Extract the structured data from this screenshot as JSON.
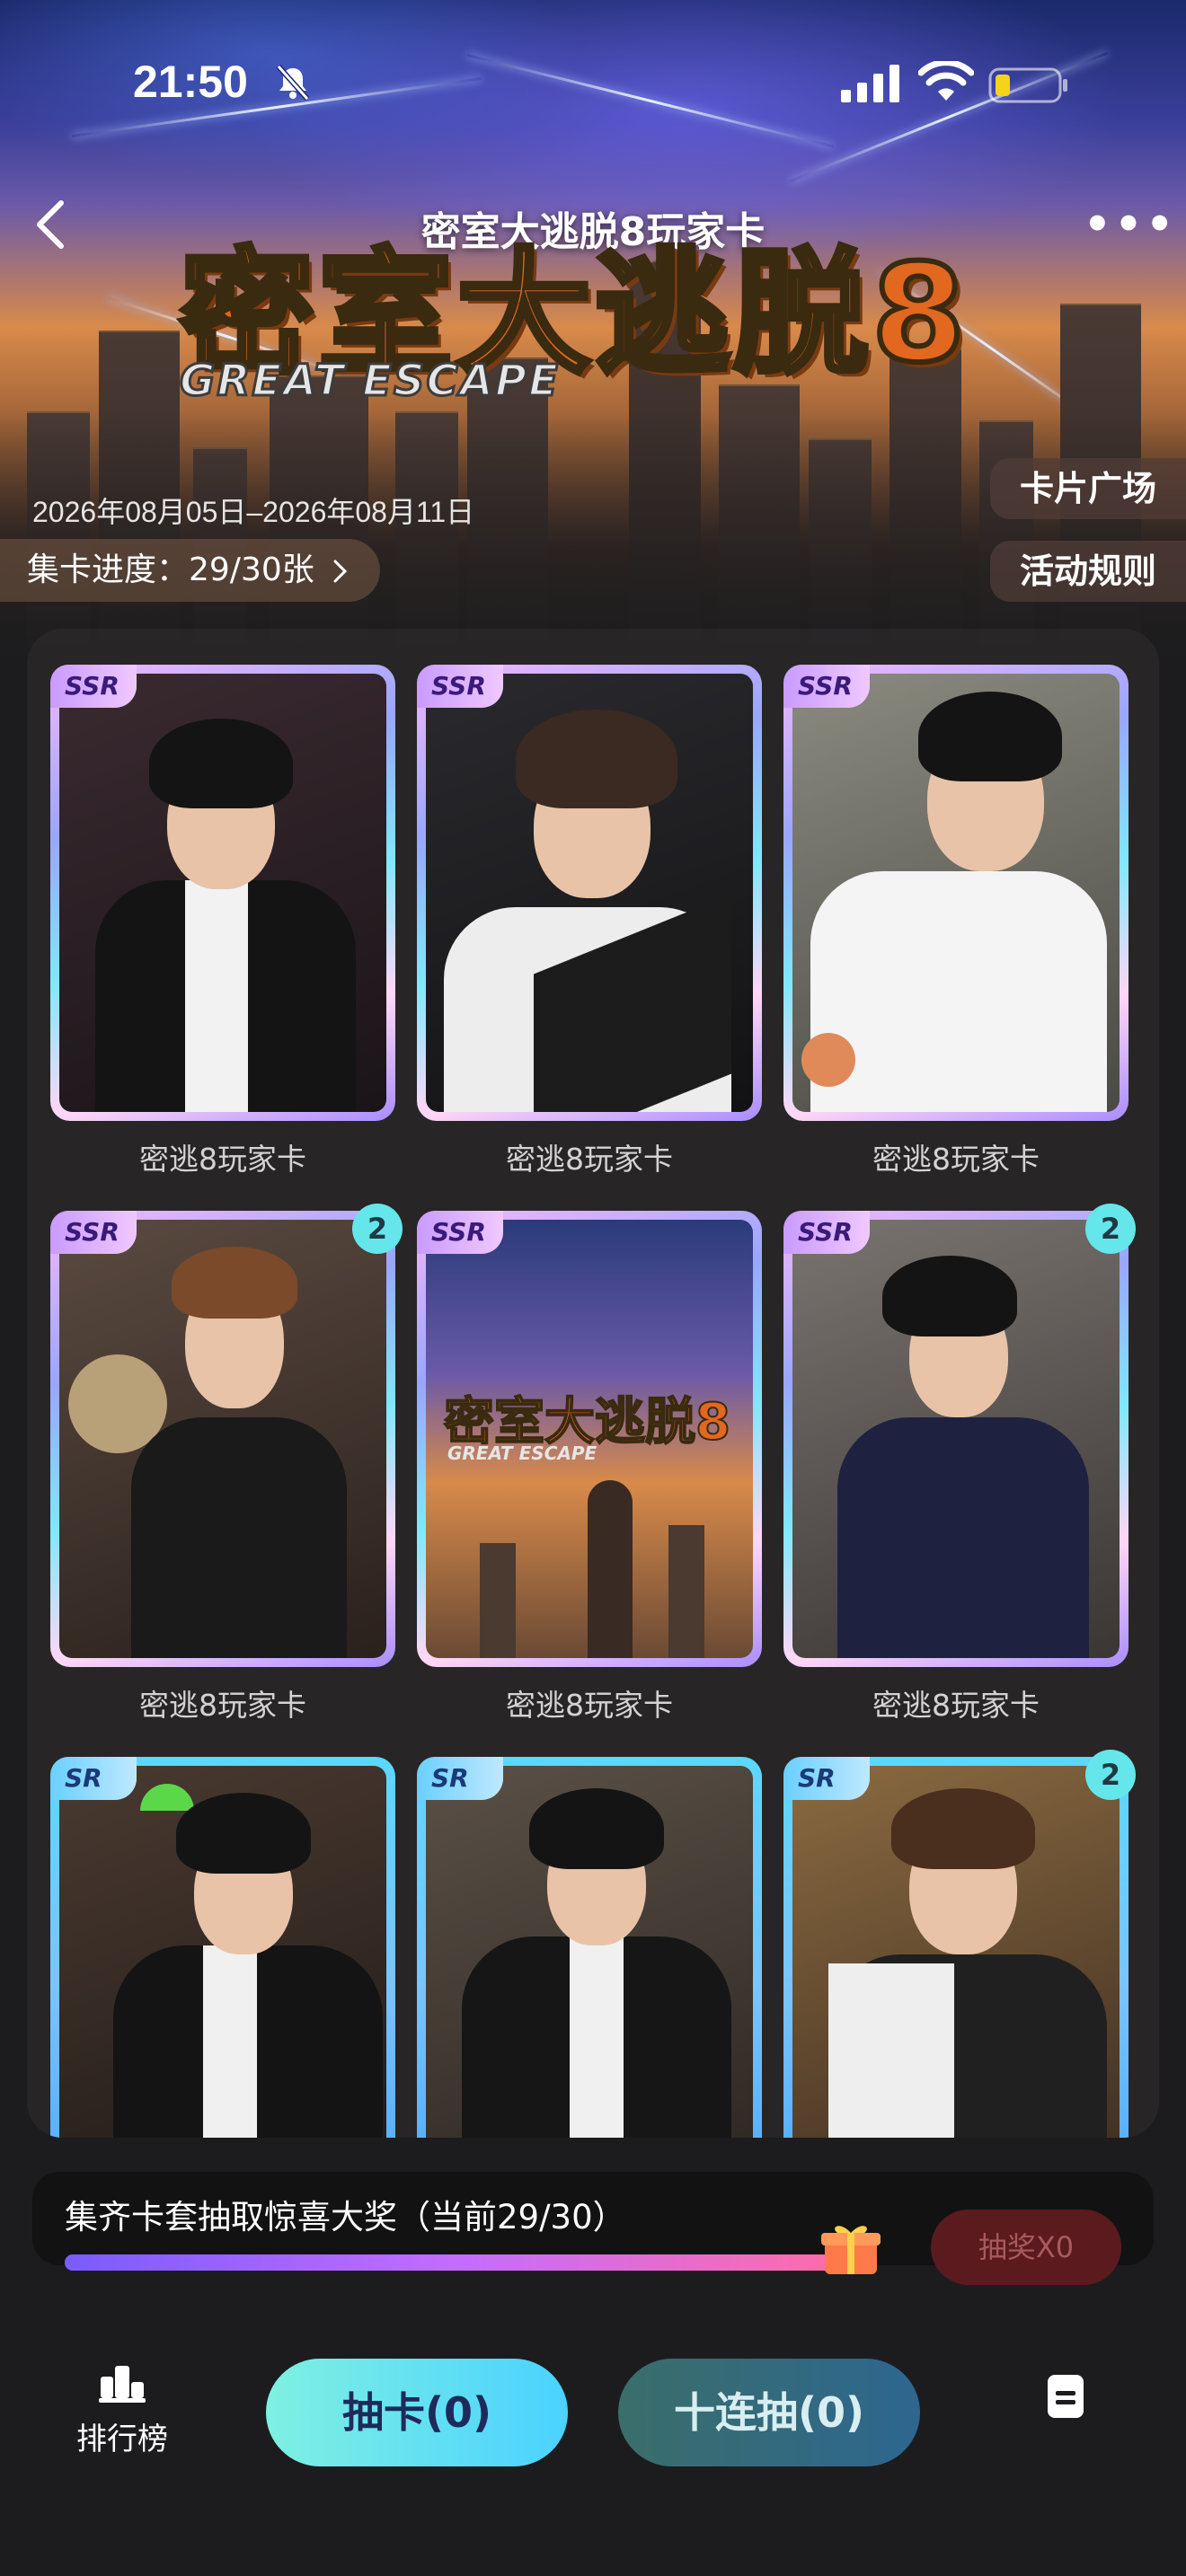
{
  "status_bar": {
    "time": "21:50"
  },
  "header": {
    "title": "密室大逃脱8玩家卡",
    "logo_text": "密室大逃脱8",
    "logo_sub": "GREAT ESCAPE"
  },
  "event": {
    "date_range": "2026年08月05日–2026年08月11日",
    "progress_label": "集卡进度：29/30张",
    "card_plaza": "卡片广场",
    "rules": "活动规则"
  },
  "cards": [
    {
      "rarity": "SSR",
      "label": "密逃8玩家卡",
      "count": ""
    },
    {
      "rarity": "SSR",
      "label": "密逃8玩家卡",
      "count": ""
    },
    {
      "rarity": "SSR",
      "label": "密逃8玩家卡",
      "count": ""
    },
    {
      "rarity": "SSR",
      "label": "密逃8玩家卡",
      "count": "2"
    },
    {
      "rarity": "SSR",
      "label": "密逃8玩家卡",
      "count": ""
    },
    {
      "rarity": "SSR",
      "label": "密逃8玩家卡",
      "count": "2"
    },
    {
      "rarity": "SR",
      "label": "",
      "count": ""
    },
    {
      "rarity": "SR",
      "label": "",
      "count": ""
    },
    {
      "rarity": "SR",
      "label": "",
      "count": "2"
    }
  ],
  "lottery": {
    "title": "集齐卡套抽取惊喜大奖（当前29/30）",
    "progress": 0.967,
    "button": "抽奖X0"
  },
  "bottom_bar": {
    "ranking": "排行榜",
    "draw": "抽卡(0)",
    "ten_draw": "十连抽(0)"
  },
  "colors": {
    "background": "#1c1c1e",
    "accent_cyan": "#64e6ea",
    "ssr_frame": "#a98dff",
    "sr_frame": "#5ad8ff"
  },
  "icons": [
    "bell-off-icon",
    "signal-icon",
    "wifi-icon",
    "battery-icon",
    "back-icon",
    "more-icon",
    "chevron-right-icon",
    "gift-icon",
    "ranking-icon",
    "document-icon"
  ]
}
